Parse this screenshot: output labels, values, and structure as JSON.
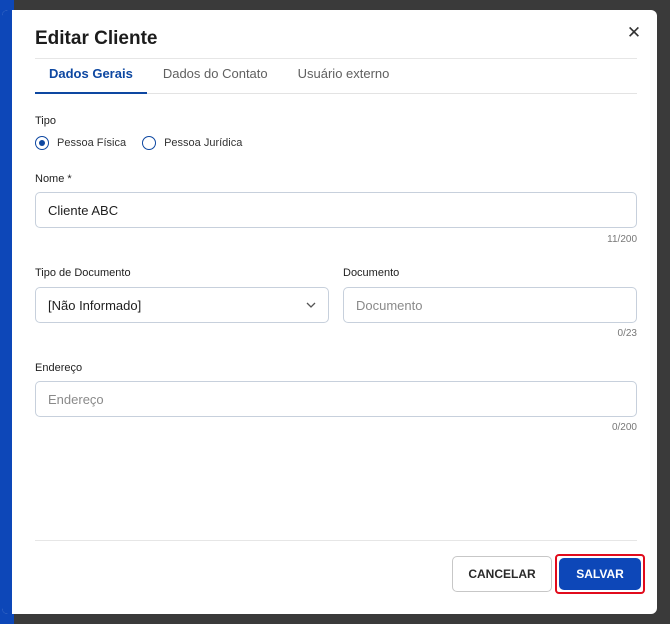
{
  "dialog": {
    "title": "Editar Cliente",
    "close_icon": "close-icon"
  },
  "tabs": [
    {
      "label": "Dados Gerais",
      "active": true
    },
    {
      "label": "Dados do Contato",
      "active": false
    },
    {
      "label": "Usuário externo",
      "active": false
    }
  ],
  "form": {
    "tipo": {
      "label": "Tipo",
      "options": [
        {
          "label": "Pessoa Física",
          "checked": true
        },
        {
          "label": "Pessoa Jurídica",
          "checked": false
        }
      ]
    },
    "nome": {
      "label": "Nome *",
      "value": "Cliente ABC",
      "counter": "11/200"
    },
    "tipo_documento": {
      "label": "Tipo de Documento",
      "value": "[Não Informado]"
    },
    "documento": {
      "label": "Documento",
      "placeholder": "Documento",
      "counter": "0/23"
    },
    "endereco": {
      "label": "Endereço",
      "placeholder": "Endereço",
      "counter": "0/200"
    }
  },
  "actions": {
    "cancel_label": "CANCELAR",
    "save_label": "SALVAR"
  },
  "colors": {
    "primary": "#0d47b8",
    "highlight_border": "#e10b1c"
  }
}
